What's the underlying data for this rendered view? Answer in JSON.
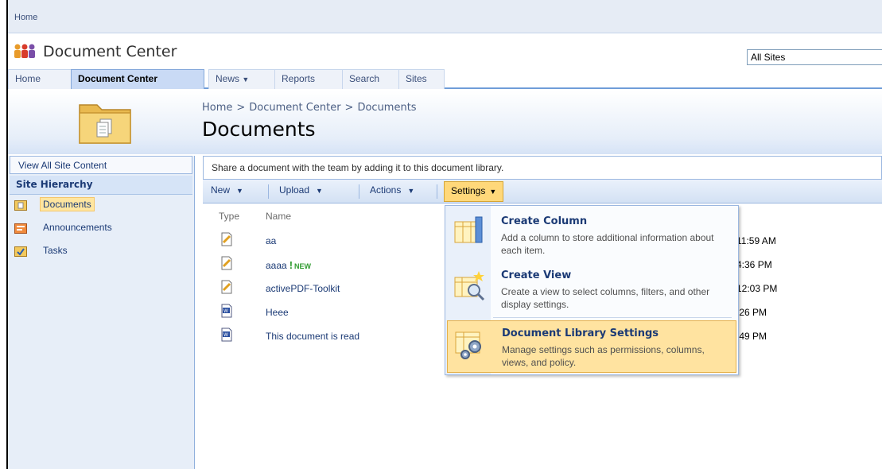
{
  "global": {
    "home_link": "Home"
  },
  "site": {
    "title": "Document Center"
  },
  "search": {
    "scope": "All Sites"
  },
  "topnav": {
    "tabs": [
      {
        "label": "Home",
        "active": false
      },
      {
        "label": "Document Center",
        "active": true
      },
      {
        "label": "News",
        "dropdown": true
      },
      {
        "label": "Reports"
      },
      {
        "label": "Search"
      },
      {
        "label": "Sites"
      }
    ]
  },
  "breadcrumb": {
    "items": [
      "Home",
      "Document Center",
      "Documents"
    ],
    "separator": ">"
  },
  "page": {
    "title": "Documents",
    "description": "Share a document with the team by adding it to this document library."
  },
  "quicklaunch": {
    "view_all": "View All Site Content",
    "heading": "Site Hierarchy",
    "items": [
      {
        "label": "Documents",
        "icon": "document-library-icon",
        "selected": true
      },
      {
        "label": "Announcements",
        "icon": "announcements-icon"
      },
      {
        "label": "Tasks",
        "icon": "tasks-icon"
      }
    ]
  },
  "toolbar": {
    "new": "New",
    "upload": "Upload",
    "actions": "Actions",
    "settings": "Settings"
  },
  "list": {
    "columns": {
      "type": "Type",
      "name": "Name"
    },
    "rows": [
      {
        "name": "aa",
        "modified": "11:59 AM",
        "icon": "generic-doc-icon"
      },
      {
        "name": "aaaa",
        "badge": "NEW",
        "bang": "!",
        "modified": "4:36 PM",
        "icon": "generic-doc-icon"
      },
      {
        "name": "activePDF-Toolkit",
        "modified": "12:03 PM",
        "icon": "generic-doc-icon"
      },
      {
        "name": "Heee",
        "modified": ":26 PM",
        "icon": "word-doc-icon"
      },
      {
        "name": "This document is read",
        "modified": ":49 PM",
        "icon": "word-doc-icon"
      }
    ]
  },
  "settings_menu": {
    "items": [
      {
        "title": "Create Column",
        "desc": "Add a column to store additional information about each item.",
        "icon": "create-column-icon"
      },
      {
        "title": "Create View",
        "desc": "Create a view to select columns, filters, and other display settings.",
        "icon": "create-view-icon"
      },
      {
        "title": "Document Library Settings",
        "desc": "Manage settings such as permissions, columns, views, and policy.",
        "icon": "library-settings-icon",
        "highlighted": true
      }
    ]
  },
  "colors": {
    "link": "#1b3a75",
    "accent": "#6f9dd9",
    "highlight": "#ffe3a0",
    "new_badge": "#2f9a2f"
  }
}
